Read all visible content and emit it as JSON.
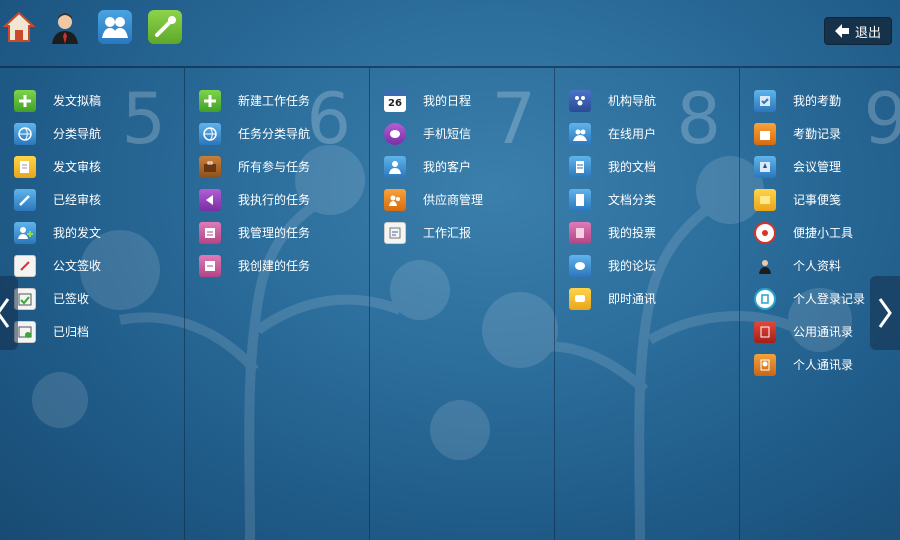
{
  "header": {
    "icons": [
      "home-icon",
      "user-avatar-icon",
      "group-icon",
      "tag-icon"
    ],
    "exit_label": "退出"
  },
  "columns": [
    {
      "number": "5",
      "items": [
        {
          "label": "发文拟稿",
          "icon": "plus-icon"
        },
        {
          "label": "分类导航",
          "icon": "globe-icon"
        },
        {
          "label": "发文审核",
          "icon": "edit-doc-icon"
        },
        {
          "label": "已经审核",
          "icon": "pen-icon"
        },
        {
          "label": "我的发文",
          "icon": "user-add-icon"
        },
        {
          "label": "公文签收",
          "icon": "sign-icon"
        },
        {
          "label": "已签收",
          "icon": "calendar-check-icon"
        },
        {
          "label": "已归档",
          "icon": "archive-icon"
        }
      ]
    },
    {
      "number": "6",
      "items": [
        {
          "label": "新建工作任务",
          "icon": "plus-icon"
        },
        {
          "label": "任务分类导航",
          "icon": "globe-icon"
        },
        {
          "label": "所有参与任务",
          "icon": "briefcase-icon"
        },
        {
          "label": "我执行的任务",
          "icon": "play-icon"
        },
        {
          "label": "我管理的任务",
          "icon": "task-manage-icon"
        },
        {
          "label": "我创建的任务",
          "icon": "task-create-icon"
        }
      ]
    },
    {
      "number": "7",
      "items": [
        {
          "label": "我的日程",
          "icon": "calendar-icon",
          "badge": "26"
        },
        {
          "label": "手机短信",
          "icon": "message-icon"
        },
        {
          "label": "我的客户",
          "icon": "customer-icon"
        },
        {
          "label": "供应商管理",
          "icon": "supplier-icon"
        },
        {
          "label": "工作汇报",
          "icon": "report-icon"
        }
      ]
    },
    {
      "number": "8",
      "items": [
        {
          "label": "机构导航",
          "icon": "org-icon"
        },
        {
          "label": "在线用户",
          "icon": "online-users-icon"
        },
        {
          "label": "我的文档",
          "icon": "document-icon"
        },
        {
          "label": "文档分类",
          "icon": "doc-category-icon"
        },
        {
          "label": "我的投票",
          "icon": "vote-icon"
        },
        {
          "label": "我的论坛",
          "icon": "forum-icon"
        },
        {
          "label": "即时通讯",
          "icon": "chat-icon"
        }
      ]
    },
    {
      "number": "9",
      "items": [
        {
          "label": "我的考勤",
          "icon": "attendance-icon"
        },
        {
          "label": "考勤记录",
          "icon": "attendance-record-icon"
        },
        {
          "label": "会议管理",
          "icon": "meeting-icon"
        },
        {
          "label": "记事便笺",
          "icon": "note-icon"
        },
        {
          "label": "便捷小工具",
          "icon": "tools-icon"
        },
        {
          "label": "个人资料",
          "icon": "profile-icon"
        },
        {
          "label": "个人登录记录",
          "icon": "login-record-icon"
        },
        {
          "label": "公用通讯录",
          "icon": "public-contacts-icon"
        },
        {
          "label": "个人通讯录",
          "icon": "personal-contacts-icon"
        }
      ]
    }
  ]
}
